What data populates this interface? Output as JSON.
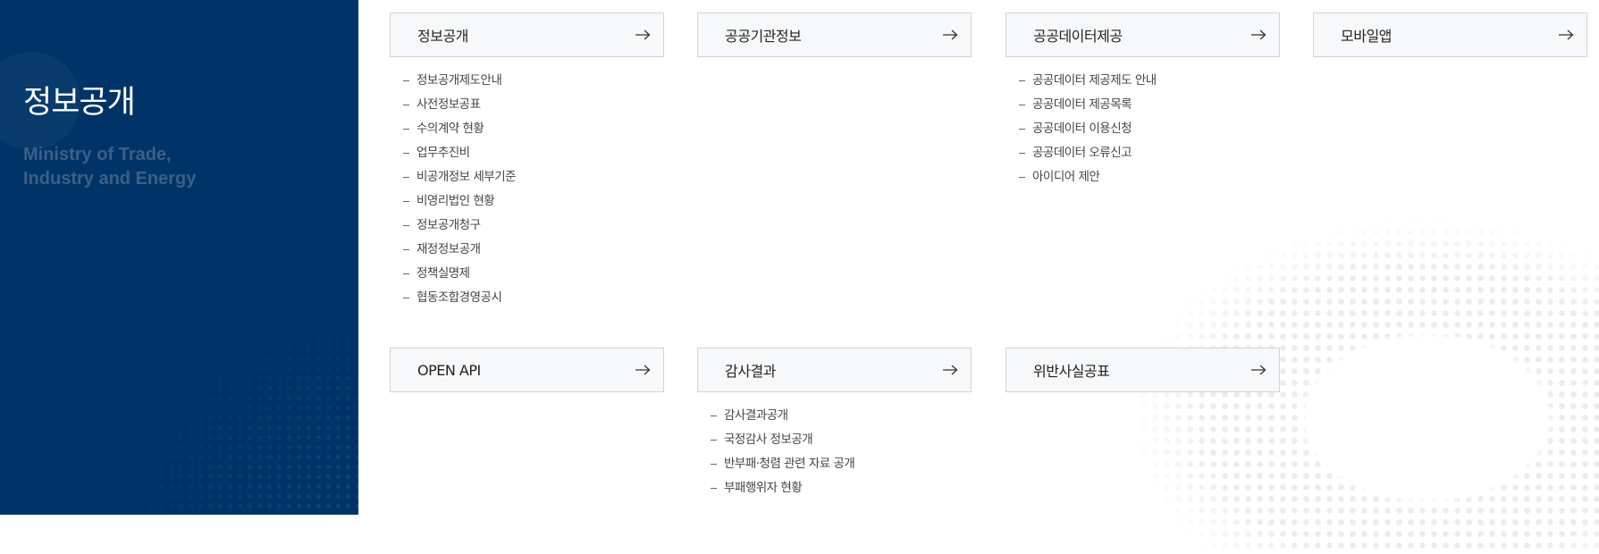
{
  "sidebar": {
    "title": "정보공개",
    "subtitle_line1": "Ministry of Trade,",
    "subtitle_line2": "Industry and Energy"
  },
  "menus": [
    {
      "label": "정보공개",
      "items": [
        "정보공개제도안내",
        "사전정보공표",
        "수의계약 현황",
        "업무추진비",
        "비공개정보 세부기준",
        "비영리법인 현황",
        "정보공개청구",
        "재정정보공개",
        "정책실명제",
        "협동조합경영공시"
      ]
    },
    {
      "label": "공공기관정보",
      "items": []
    },
    {
      "label": "공공데이터제공",
      "items": [
        "공공데이터 제공제도 안내",
        "공공데이터 제공목록",
        "공공데이터 이용신청",
        "공공데이터 오류신고",
        "아이디어 제안"
      ]
    },
    {
      "label": "모바일앱",
      "items": []
    },
    {
      "label": "OPEN API",
      "items": []
    },
    {
      "label": "감사결과",
      "items": [
        "감사결과공개",
        "국정감사 정보공개",
        "반부패·청렴 관련 자료 공개",
        "부패행위자 현황"
      ]
    },
    {
      "label": "위반사실공표",
      "items": []
    }
  ],
  "icons": {
    "menu_arrow": "arrow-right-icon"
  },
  "colors": {
    "sidebar_bg": "#003468",
    "box_bg": "#f7f8fa",
    "box_border": "#cfd3da"
  }
}
